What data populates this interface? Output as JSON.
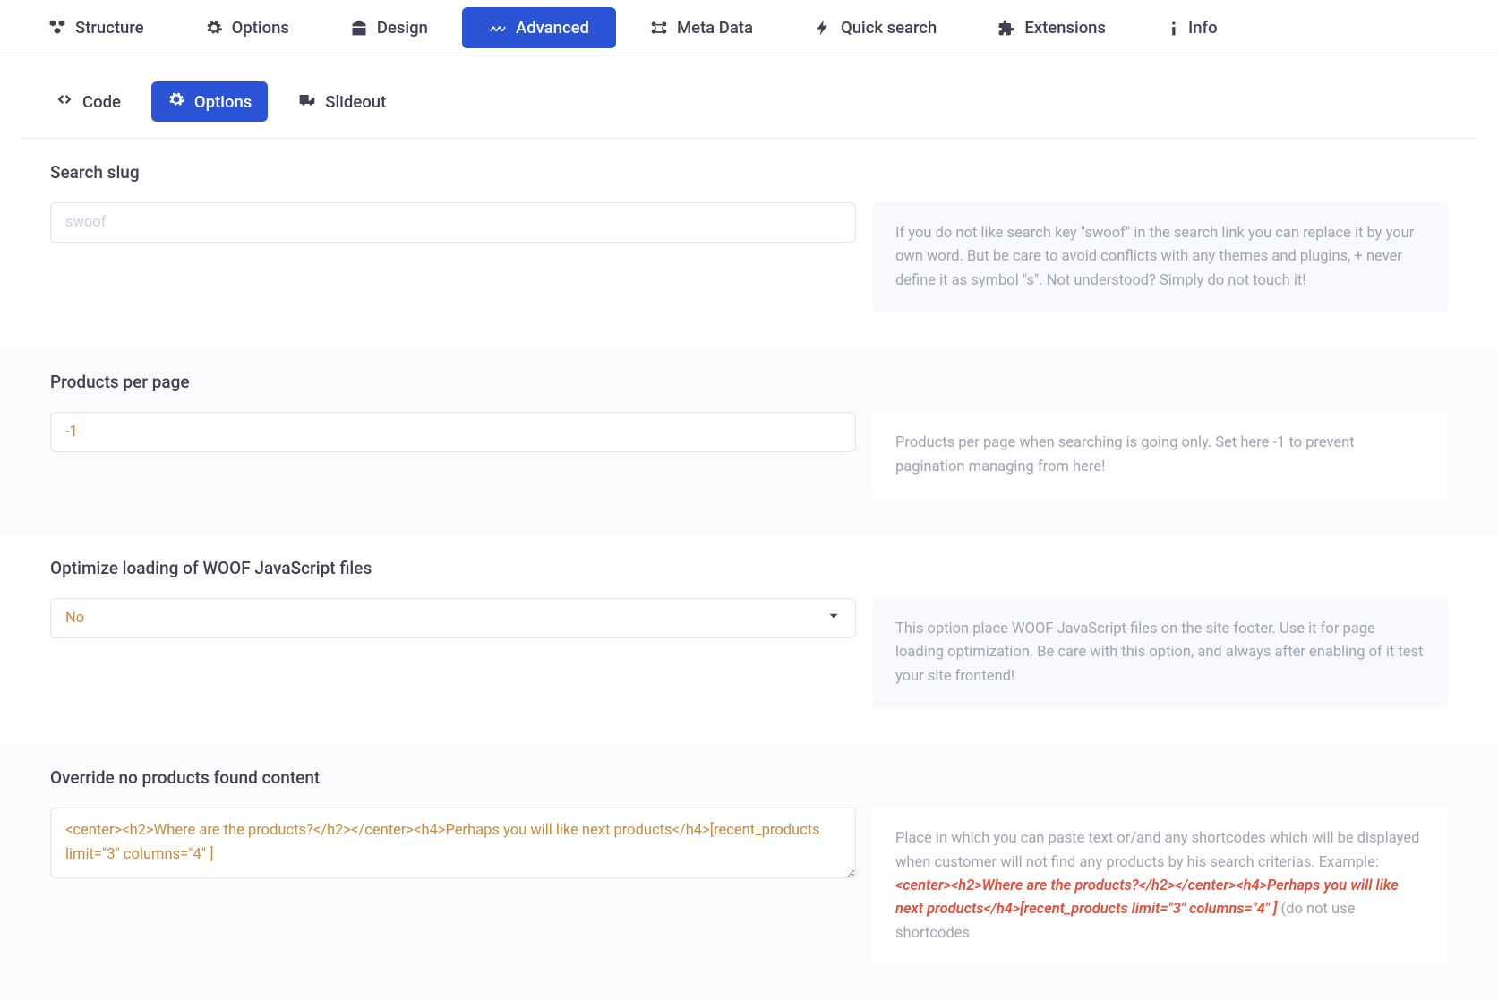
{
  "main_tabs": {
    "structure": "Structure",
    "options": "Options",
    "design": "Design",
    "advanced": "Advanced",
    "meta_data": "Meta Data",
    "quick_search": "Quick search",
    "extensions": "Extensions",
    "info": "Info"
  },
  "sub_tabs": {
    "code": "Code",
    "options": "Options",
    "slideout": "Slideout"
  },
  "sections": {
    "search_slug": {
      "title": "Search slug",
      "placeholder": "swoof",
      "help": "If you do not like search key \"swoof\" in the search link you can replace it by your own word. But be care to avoid conflicts with any themes and plugins, + never define it as symbol \"s\". Not understood? Simply do not touch it!"
    },
    "products_per_page": {
      "title": "Products per page",
      "value": "-1",
      "help": "Products per page when searching is going only. Set here -1 to prevent pagination managing from here!"
    },
    "optimize_js": {
      "title": "Optimize loading of WOOF JavaScript files",
      "selected": "No",
      "help": "This option place WOOF JavaScript files on the site footer. Use it for page loading optimization. Be care with this option, and always after enabling of it test your site frontend!"
    },
    "override_no_products": {
      "title": "Override no products found content",
      "value": "<center><h2>Where are the products?</h2></center><h4>Perhaps you will like next products</h4>[recent_products limit=\"3\" columns=\"4\" ]",
      "help_pre": "Place in which you can paste text or/and any shortcodes which will be displayed when customer will not find any products by his search criterias. Example: ",
      "help_example": "<center><h2>Where are the products?</h2></center><h4>Perhaps you will like next products</h4>[recent_products limit=\"3\" columns=\"4\" ]",
      "help_post": " (do not use shortcodes"
    }
  }
}
